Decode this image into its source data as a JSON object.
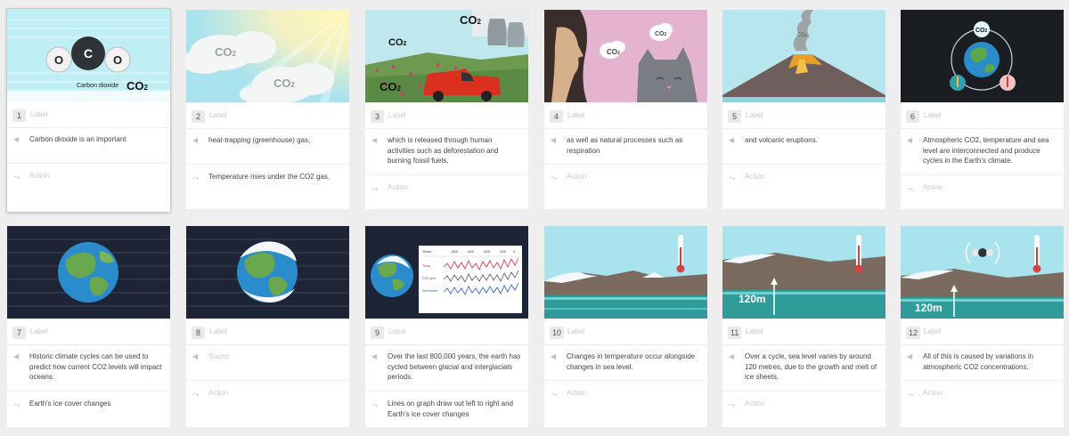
{
  "frames": [
    {
      "number": "1",
      "label": "Label",
      "voiceover": "Carbon dioxide is an important",
      "action": "Action"
    },
    {
      "number": "2",
      "label": "Label",
      "voiceover": "heat-trapping (greenhouse) gas,",
      "action": "Temperature rises under the CO2 gas."
    },
    {
      "number": "3",
      "label": "Label",
      "voiceover": "which is released through human activities such as deforestation and burning fossil fuels,",
      "action": "Action"
    },
    {
      "number": "4",
      "label": "Label",
      "voiceover": "as well as natural processes such as respiration",
      "action": "Action"
    },
    {
      "number": "5",
      "label": "Label",
      "voiceover": "and volcanic eruptions.",
      "action": "Action"
    },
    {
      "number": "6",
      "label": "Label",
      "voiceover": "Atmospheric CO2, temperature and sea level are interconnected and produce cycles in the Earth's climate.",
      "action": "Action"
    },
    {
      "number": "7",
      "label": "Label",
      "voiceover": "Historic climate cycles can be used to predict how current CO2 levels will impact oceans.",
      "action": "Earth's ice cover changes"
    },
    {
      "number": "8",
      "label": "Label",
      "voiceover": "Sound",
      "action": "Action"
    },
    {
      "number": "9",
      "label": "Label",
      "voiceover": "Over the last 800,000 years, the earth has cycled between glacial and interglacials periods.",
      "action": "Lines on graph draw out left to right and Earth's ice cover changes"
    },
    {
      "number": "10",
      "label": "Label",
      "voiceover": "Changes in temperature occur alongside changes in sea level.",
      "action": "Action"
    },
    {
      "number": "11",
      "label": "Label",
      "voiceover": "Over a cycle, sea level varies by around 120 metres, due to the growth and melt of ice sheets.",
      "action": "Action"
    },
    {
      "number": "12",
      "label": "Label",
      "voiceover": "All of this is caused by variations in atmospheric CO2 concentrations.",
      "action": "Action"
    }
  ],
  "art": {
    "co2": "CO2",
    "co2_main": "CO",
    "subscript_2": "2",
    "carbon_dioxide": "Carbon dioxide",
    "atom_o": "O",
    "atom_c": "C",
    "sea_level_label": "120m",
    "graph_headers": [
      "Years",
      "-800",
      "-600",
      "-400",
      "-200",
      "0"
    ],
    "graph_rows": [
      "Temp",
      "CO2 ppm",
      "Sea levels"
    ]
  },
  "colors": {
    "page_bg": "#eeeeee",
    "sky_cyan": "#a8e3ee",
    "sea_teal": "#2f9c9a",
    "dark_space": "#1c2436",
    "truck_red": "#d9301f"
  }
}
